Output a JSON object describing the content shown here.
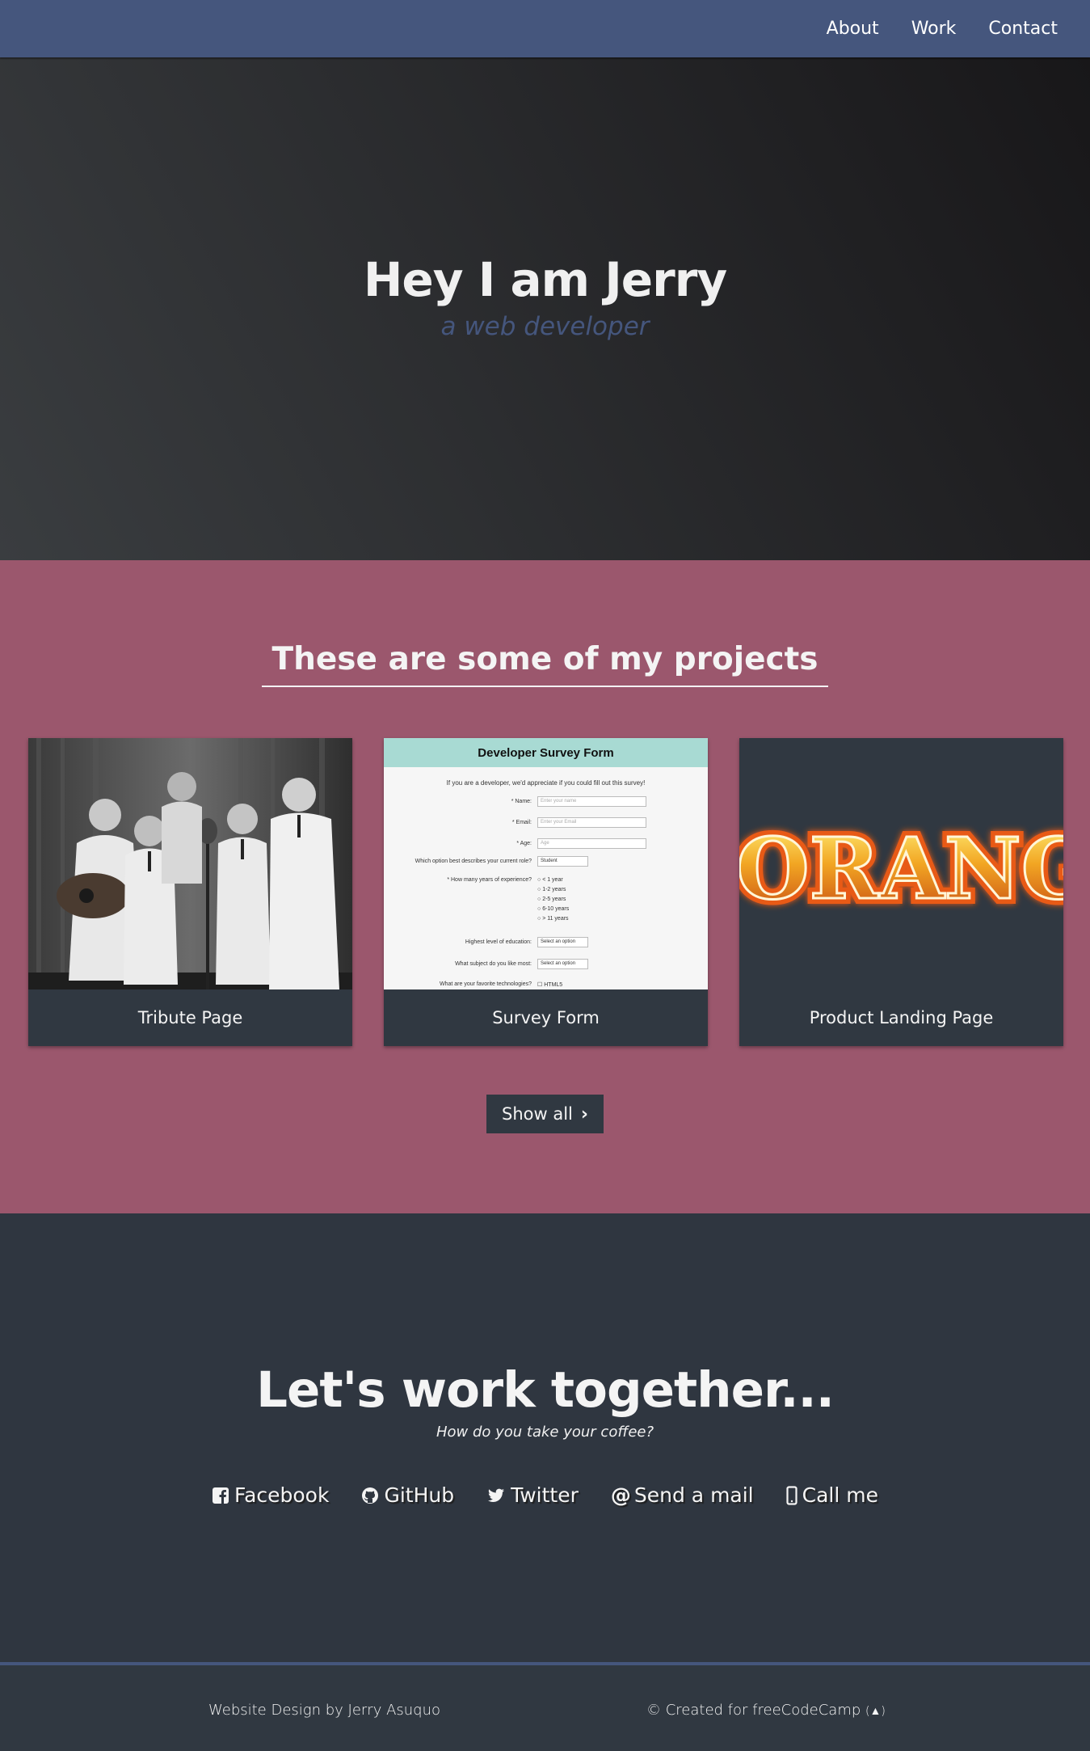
{
  "nav": {
    "about": "About",
    "work": "Work",
    "contact": "Contact"
  },
  "hero": {
    "title": "Hey I am Jerry",
    "subtitle": "a web developer"
  },
  "projects": {
    "heading": "These are some of my projects",
    "tiles": [
      {
        "caption": "Tribute Page"
      },
      {
        "caption": "Survey Form"
      },
      {
        "caption": "Product Landing Page"
      }
    ],
    "show_all": "Show all"
  },
  "survey_preview": {
    "title": "Developer Survey Form",
    "intro": "If you are a developer, we'd appreciate if you could fill out this survey!",
    "name_label": "* Name:",
    "name_placeholder": "Enter your name",
    "email_label": "* Email:",
    "email_placeholder": "Enter your Email",
    "age_label": "* Age:",
    "age_placeholder": "Age",
    "role_label": "Which option best describes your current role?",
    "role_value": "Student",
    "years_label": "* How many years of experience?",
    "years_options": [
      "< 1 year",
      "1-2 years",
      "2-5 years",
      "6-10 years",
      "> 11 years"
    ],
    "education_label": "Highest level of education:",
    "education_value": "Select an option",
    "subject_label": "What subject do you like most:",
    "subject_value": "Select an option",
    "tech_label": "What are your favorite technologies?",
    "tech_value": "HTML5"
  },
  "orange_logo_text": "ORANG",
  "contact": {
    "heading": "Let's work together...",
    "tagline": "How do you take your coffee?",
    "links": {
      "facebook": "Facebook",
      "github": "GitHub",
      "twitter": "Twitter",
      "mail": "Send a mail",
      "call": "Call me"
    }
  },
  "footer": {
    "credit": "Website Design by Jerry Asuquo",
    "created": "© Created for freeCodeCamp"
  },
  "colors": {
    "nav": "#45567d",
    "projects_bg": "#9b576d",
    "dark": "#303841",
    "subtitle": "#45567d"
  }
}
